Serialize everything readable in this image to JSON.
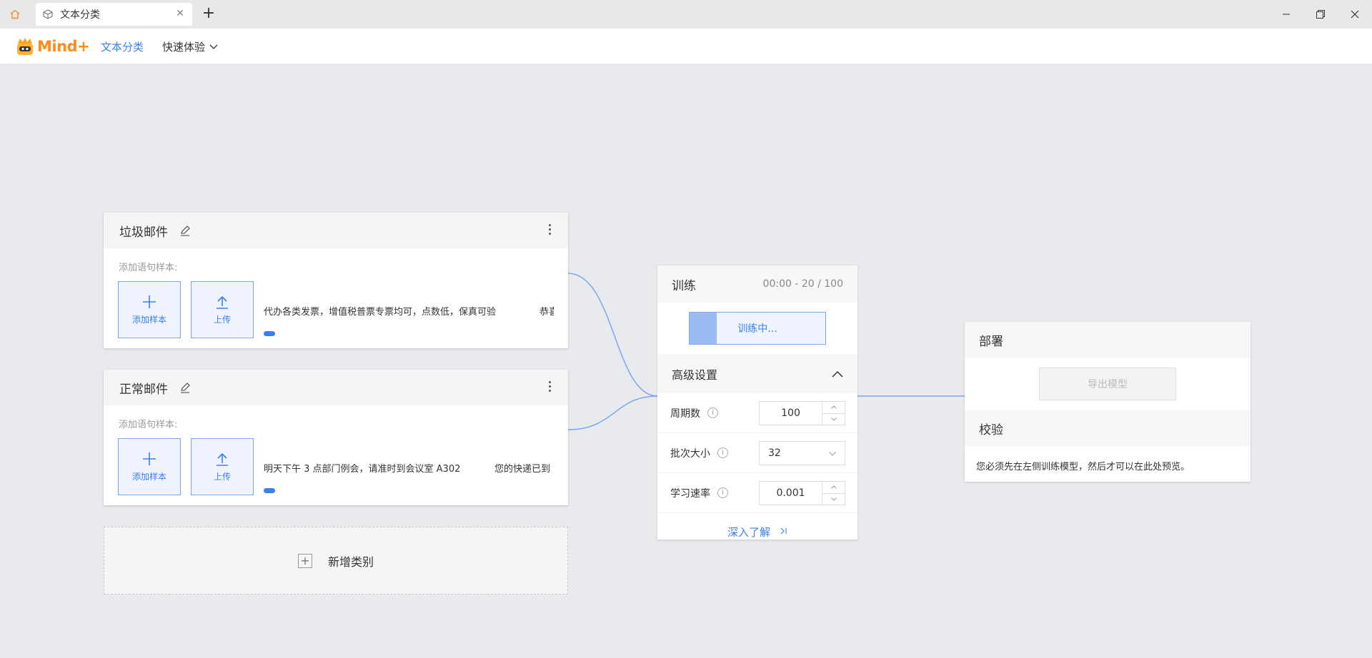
{
  "window": {
    "tab_label": "文本分类"
  },
  "appbar": {
    "logo_text": "Mind+",
    "nav_active": "文本分类",
    "nav_menu": "快速体验"
  },
  "classes": [
    {
      "title": "垃圾邮件",
      "sample_label": "添加语句样本:",
      "add_sample_label": "添加样本",
      "upload_label": "上传",
      "samples": [
        "代办各类发票，增值税普票专票均可，点数低，保真可验",
        "恭喜"
      ]
    },
    {
      "title": "正常邮件",
      "sample_label": "添加语句样本:",
      "add_sample_label": "添加样本",
      "upload_label": "上传",
      "samples": [
        "明天下午 3 点部门例会，请准时到会议室 A302",
        "您的快递已到"
      ]
    }
  ],
  "add_class_label": "新增类别",
  "train": {
    "title": "训练",
    "timer": "00:00 - 20 / 100",
    "button_label": "训练中...",
    "progress": 0.2,
    "advanced_title": "高级设置",
    "params": {
      "epochs_label": "周期数",
      "epochs_value": "100",
      "batch_label": "批次大小",
      "batch_value": "32",
      "lr_label": "学习速率",
      "lr_value": "0.001"
    },
    "learn_more": "深入了解"
  },
  "deploy": {
    "title": "部署",
    "export_label": "导出模型",
    "verify_title": "校验",
    "verify_text": "您必须先在左侧训练模型，然后才可以在此处预览。"
  },
  "colors": {
    "accent": "#3a7ff0",
    "brand": "#ff8c1a",
    "wire": "#7aa7ee"
  }
}
